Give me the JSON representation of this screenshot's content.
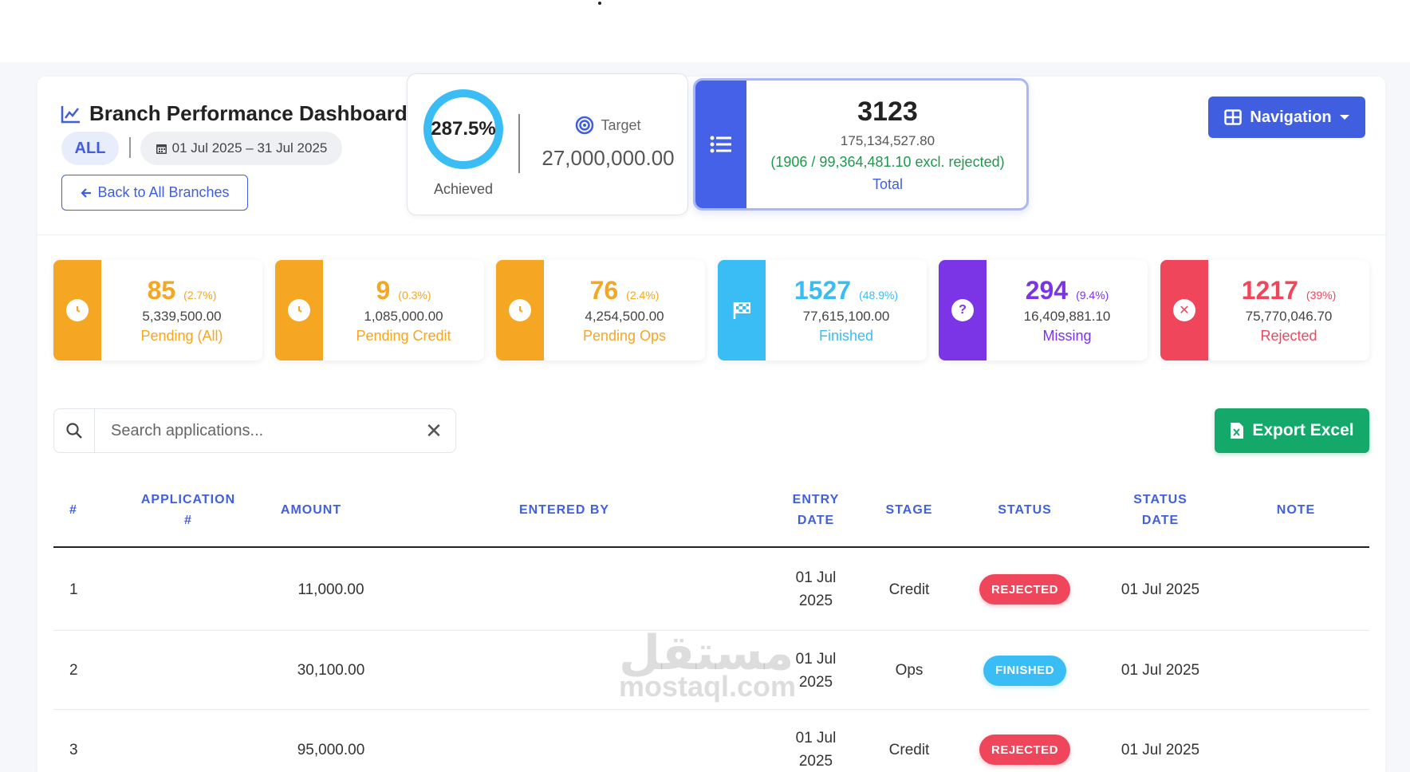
{
  "header": {
    "title": "Branch Performance Dashboard",
    "scope_chip": "ALL",
    "date_range": "01 Jul 2025 – 31 Jul 2025",
    "back_label": "Back to All Branches",
    "nav_label": "Navigation"
  },
  "achievement": {
    "percent_text": "287.5%",
    "achieved_label": "Achieved",
    "target_label": "Target",
    "target_value": "27,000,000.00"
  },
  "total": {
    "count": "3123",
    "amount": "175,134,527.80",
    "excl_note": "(1906 / 99,364,481.10 excl. rejected)",
    "label": "Total"
  },
  "stats": [
    {
      "count": "85",
      "pct": "(2.7%)",
      "amount": "5,339,500.00",
      "label": "Pending (All)",
      "color": "#f5a623",
      "icon": "clock-icon"
    },
    {
      "count": "9",
      "pct": "(0.3%)",
      "amount": "1,085,000.00",
      "label": "Pending Credit",
      "color": "#f5a623",
      "icon": "clock-icon"
    },
    {
      "count": "76",
      "pct": "(2.4%)",
      "amount": "4,254,500.00",
      "label": "Pending Ops",
      "color": "#f5a623",
      "icon": "clock-icon"
    },
    {
      "count": "1527",
      "pct": "(48.9%)",
      "amount": "77,615,100.00",
      "label": "Finished",
      "color": "#3abdf5",
      "icon": "flag-checkered-icon"
    },
    {
      "count": "294",
      "pct": "(9.4%)",
      "amount": "16,409,881.10",
      "label": "Missing",
      "color": "#7b35e6",
      "icon": "question-icon"
    },
    {
      "count": "1217",
      "pct": "(39%)",
      "amount": "75,770,046.70",
      "label": "Rejected",
      "color": "#f0465c",
      "icon": "x-circle-icon"
    }
  ],
  "search": {
    "placeholder": "Search applications...",
    "value": ""
  },
  "export_label": "Export Excel",
  "table": {
    "headers": {
      "idx": "#",
      "app_line1": "APPLICATION",
      "app_line2": "#",
      "amount": "AMOUNT",
      "entered_by": "ENTERED BY",
      "entry_line1": "ENTRY",
      "entry_line2": "DATE",
      "stage": "STAGE",
      "status": "STATUS",
      "sd_line1": "STATUS",
      "sd_line2": "DATE",
      "note": "NOTE"
    },
    "rows": [
      {
        "idx": "1",
        "app": "",
        "amount": "11,000.00",
        "entered_by": "",
        "entry_l1": "01 Jul",
        "entry_l2": "2025",
        "stage": "Credit",
        "status": "REJECTED",
        "status_date": "01 Jul 2025",
        "note": ""
      },
      {
        "idx": "2",
        "app": "",
        "amount": "30,100.00",
        "entered_by": "",
        "entry_l1": "01 Jul",
        "entry_l2": "2025",
        "stage": "Ops",
        "status": "FINISHED",
        "status_date": "01 Jul 2025",
        "note": ""
      },
      {
        "idx": "3",
        "app": "",
        "amount": "95,000.00",
        "entered_by": "",
        "entry_l1": "01 Jul",
        "entry_l2": "2025",
        "stage": "Credit",
        "status": "REJECTED",
        "status_date": "01 Jul 2025",
        "note": ""
      }
    ]
  },
  "watermark": {
    "arabic": "مستقل",
    "latin": "mostaql.com"
  }
}
